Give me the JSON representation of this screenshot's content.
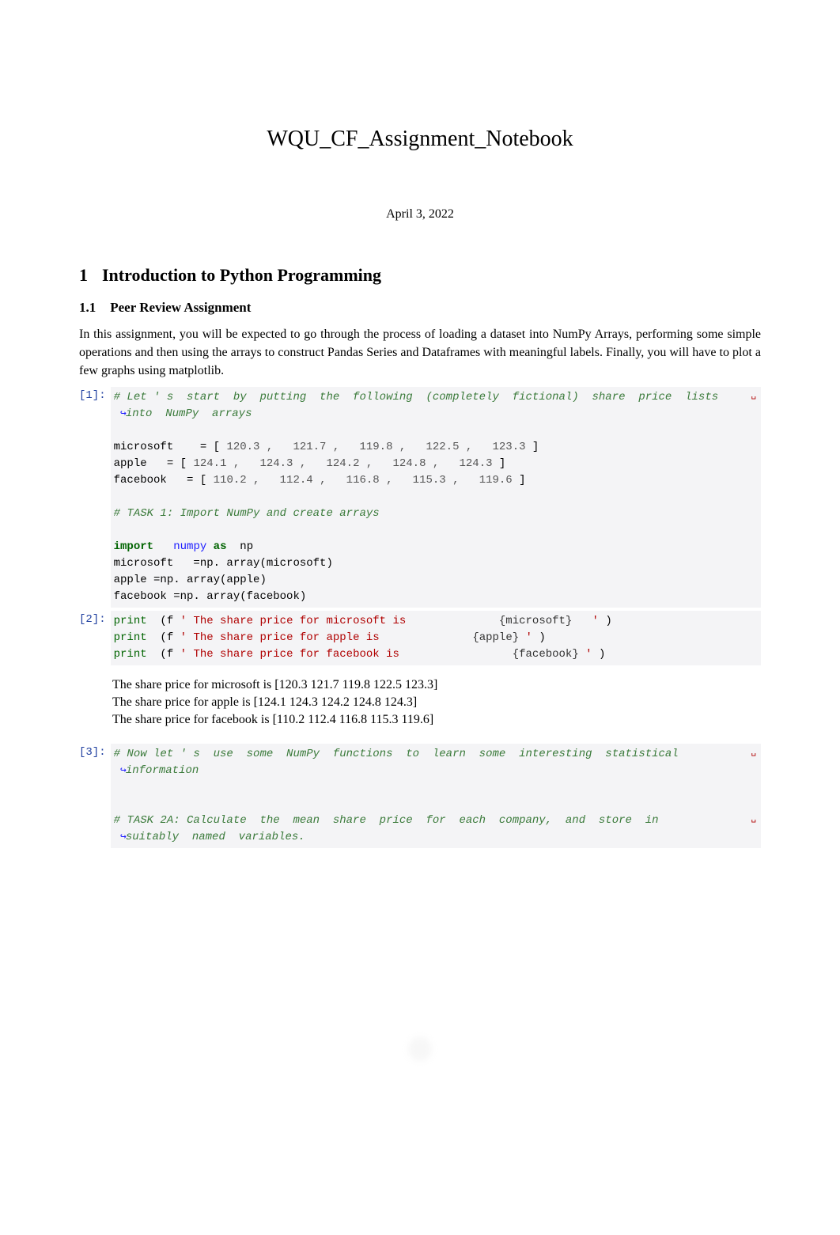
{
  "title": "WQU_CF_Assignment_Notebook",
  "date": "April 3, 2022",
  "section1_num": "1",
  "section1_title": "Introduction to Python Programming",
  "section11_num": "1.1",
  "section11_title": "Peer Review Assignment",
  "intro_paragraph": "In this assignment, you will be expected to go through the process of loading a dataset into NumPy Arrays, performing some simple operations and then using the arrays to construct Pandas Series and Dataframes with meaningful labels. Finally, you will have to plot a few graphs using matplotlib.",
  "cells": {
    "c1": {
      "prompt": "[1]:",
      "comment1a": "# Let ' s  start  by  putting  the  following  (completely  fictional)  share  price  lists",
      "comment1b": "into  NumPy  arrays",
      "line_msft_lhs": "microsoft    = [ ",
      "msft_vals": "120.3 ,   121.7 ,   119.8 ,   122.5 ,   123.3",
      "line_msft_rhs": " ]",
      "line_aapl_lhs": "apple   = [ ",
      "aapl_vals": "124.1 ,   124.3 ,   124.2 ,   124.8 ,   124.3",
      "line_aapl_rhs": " ]",
      "line_fb_lhs": "facebook   = [ ",
      "fb_vals": "110.2 ,   112.4 ,   116.8 ,   115.3 ,   119.6",
      "line_fb_rhs": " ]",
      "comment2": "# TASK 1: Import NumPy and create arrays",
      "kw_import": "import",
      "mod_numpy": "numpy",
      "kw_as": "as",
      "alias_np": "np",
      "assign_msft": "microsoft   =np. array(microsoft)",
      "assign_aapl": "apple =np. array(apple)",
      "assign_fb": "facebook =np. array(facebook)"
    },
    "c2": {
      "prompt": "[2]:",
      "kw_print": "print",
      "p1_a": "  (f ",
      "p1_str_a": "' The share price for microsoft is              ",
      "p1_br": "{microsoft}",
      "p1_str_b": "   ' ",
      "p1_c": ")",
      "p2_a": "  (f ",
      "p2_str_a": "' The share price for apple is              ",
      "p2_br": "{apple}",
      "p2_str_b": " ' ",
      "p2_c": ")",
      "p3_a": "  (f ",
      "p3_str_a": "' The share price for facebook is                 ",
      "p3_br": "{facebook}",
      "p3_str_b": " ' ",
      "p3_c": ")"
    },
    "out2": {
      "line1": "The share price for microsoft is [120.3 121.7 119.8 122.5 123.3]",
      "line2": "The share price for apple is [124.1 124.3 124.2 124.8 124.3]",
      "line3": "The share price for facebook is [110.2 112.4 116.8 115.3 119.6]"
    },
    "c3": {
      "prompt": "[3]:",
      "comment1a": "# Now let ' s  use  some  NumPy  functions  to  learn  some  interesting  statistical",
      "comment1b": "information",
      "comment2a": "# TASK 2A: Calculate  the  mean  share  price  for  each  company,  and  store  in",
      "comment2b": "suitably  named  variables."
    }
  },
  "continuation_glyph": "↪",
  "wrap_glyph": "␣",
  "page_number": "1"
}
